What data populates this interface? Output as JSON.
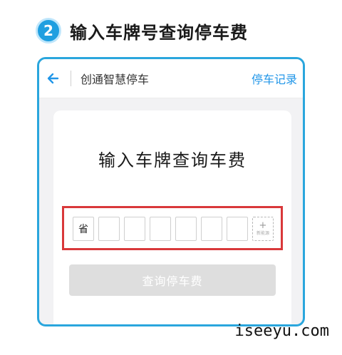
{
  "step": {
    "number": "2",
    "title": "输入车牌号查询停车费"
  },
  "nav": {
    "title": "创通智慧停车",
    "records": "停车记录"
  },
  "card": {
    "title": "输入车牌查询车费"
  },
  "plate": {
    "province": "省",
    "new_energy_plus": "+",
    "new_energy_label": "新能源"
  },
  "query_button": "查询停车费",
  "watermark": "iseeyu.com",
  "colors": {
    "accent": "#2aa6dd",
    "link": "#2196e8",
    "highlight": "#d9383a"
  },
  "icons": {
    "back": "back-arrow-icon"
  }
}
